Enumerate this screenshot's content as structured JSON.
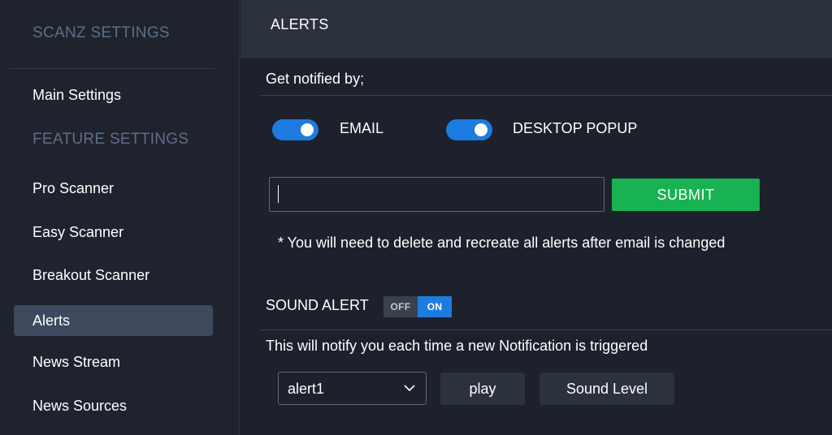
{
  "sidebar": {
    "title": "SCANZ SETTINGS",
    "main_settings": "Main Settings",
    "section_label": "FEATURE SETTINGS",
    "items": [
      {
        "label": "Pro Scanner"
      },
      {
        "label": "Easy Scanner"
      },
      {
        "label": "Breakout Scanner"
      },
      {
        "label": "Alerts",
        "active": true
      },
      {
        "label": "News Stream"
      },
      {
        "label": "News Sources"
      }
    ]
  },
  "header": {
    "title": "ALERTS"
  },
  "notify": {
    "heading": "Get notified by;",
    "email_label": "EMAIL",
    "email_enabled": true,
    "desktop_label": "DESKTOP POPUP",
    "desktop_enabled": true,
    "email_value": "",
    "submit_label": "SUBMIT",
    "note": "* You will need to delete and recreate all alerts after email is changed"
  },
  "sound": {
    "heading": "SOUND ALERT",
    "off_label": "OFF",
    "on_label": "ON",
    "state": "ON",
    "description": "This will notify you each time a new Notification is triggered",
    "selected_sound": "alert1",
    "play_label": "play",
    "level_label": "Sound Level"
  },
  "colors": {
    "toggle_on": "#1e7be0",
    "submit_green": "#18b252",
    "sidebar_active": "#3e495d"
  }
}
